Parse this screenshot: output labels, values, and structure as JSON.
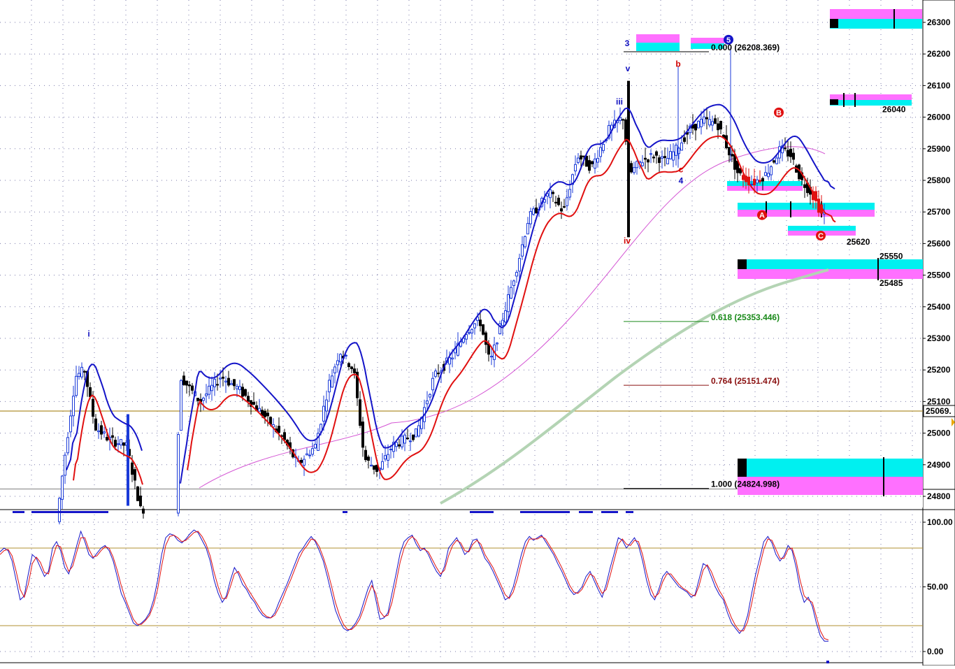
{
  "chart_data": [
    {
      "type": "candlestick",
      "title": "",
      "xlabel": "",
      "ylabel": "",
      "ylim": [
        24760,
        26360
      ],
      "y_ticks": [
        "26300",
        "26200",
        "26100",
        "26000",
        "25900",
        "25800",
        "25700",
        "25600",
        "25500",
        "25400",
        "25300",
        "25200",
        "25100",
        "25000",
        "24900",
        "24800"
      ],
      "current_price_label": "25069.",
      "grid": true,
      "colors": {
        "bull": "#1a3ad8",
        "bear": "#000000",
        "red_candle": "#e01010",
        "fast_band": "#1414c8",
        "slow_band": "#e01010",
        "sma_pink": "#d455d4",
        "sma_green": "#b4d4b4",
        "fib_zero": "#000000",
        "fib_618": "#1a8a1a",
        "fib_764": "#8a1010",
        "fib_1000": "#000000",
        "box_cyan": "#00f0f0",
        "box_magenta": "#ff70ff",
        "hline": "#b09030"
      },
      "fib_levels": [
        {
          "label": "0.000",
          "value_text": "(26208.369)",
          "price": 26208.369
        },
        {
          "label": "0.618",
          "value_text": "(25353.446)",
          "price": 25353.446
        },
        {
          "label": "0.764",
          "value_text": "(25151.474)",
          "price": 25151.474
        },
        {
          "label": "1.000",
          "value_text": "(24824.998)",
          "price": 24824.998
        }
      ],
      "level_labels": [
        {
          "text": "26040",
          "price": 26025
        },
        {
          "text": "25620",
          "price": 25605
        },
        {
          "text": "25550",
          "price": 25560
        },
        {
          "text": "25485",
          "price": 25475
        }
      ],
      "wave_labels": [
        {
          "text": "i",
          "color": "blue",
          "price": 25305
        },
        {
          "text": "3",
          "color": "blue",
          "price": 26225
        },
        {
          "text": "v",
          "color": "blue",
          "price": 26145
        },
        {
          "text": "iii",
          "color": "blue",
          "price": 26040
        },
        {
          "text": "iv",
          "color": "red",
          "price": 25600
        },
        {
          "text": "b",
          "color": "red",
          "price": 26160
        },
        {
          "text": "c",
          "color": "red",
          "price": 25825
        },
        {
          "text": "4",
          "color": "blue",
          "price": 25790
        },
        {
          "text": "5",
          "color": "circle-blue",
          "price": 26245
        },
        {
          "text": "B",
          "color": "circle-red",
          "price": 26015
        },
        {
          "text": "A",
          "color": "circle-red",
          "price": 25690
        },
        {
          "text": "C",
          "color": "circle-red",
          "price": 25625
        }
      ]
    },
    {
      "type": "line",
      "title": "",
      "ylim": [
        0,
        100
      ],
      "y_ticks": [
        "100.00",
        "50.00",
        "0.00"
      ],
      "reference_levels": [
        80,
        20
      ],
      "series": [
        {
          "color": "#1414c8",
          "values": [
            77,
            80,
            78,
            70,
            55,
            40,
            43,
            60,
            75,
            72,
            65,
            58,
            62,
            80,
            85,
            78,
            65,
            60,
            70,
            82,
            93,
            85,
            75,
            72,
            76,
            80,
            82,
            78,
            70,
            58,
            45,
            38,
            30,
            22,
            20,
            22,
            25,
            30,
            40,
            55,
            75,
            88,
            91,
            90,
            86,
            84,
            87,
            91,
            94,
            92,
            86,
            80,
            70,
            55,
            45,
            38,
            43,
            55,
            65,
            60,
            52,
            48,
            42,
            38,
            32,
            28,
            26,
            26,
            30,
            38,
            45,
            52,
            60,
            68,
            76,
            80,
            85,
            89,
            85,
            78,
            70,
            58,
            45,
            32,
            24,
            18,
            16,
            18,
            22,
            28,
            38,
            48,
            55,
            40,
            25,
            26,
            30,
            45,
            60,
            76,
            85,
            88,
            90,
            83,
            78,
            80,
            75,
            68,
            62,
            58,
            66,
            80,
            84,
            88,
            82,
            75,
            78,
            86,
            87,
            80,
            72,
            68,
            62,
            55,
            48,
            40,
            42,
            50,
            62,
            75,
            85,
            89,
            86,
            88,
            90,
            85,
            80,
            75,
            68,
            62,
            55,
            48,
            44,
            46,
            50,
            58,
            62,
            55,
            48,
            42,
            52,
            65,
            76,
            88,
            86,
            80,
            84,
            88,
            82,
            70,
            55,
            44,
            40,
            48,
            58,
            62,
            58,
            54,
            50,
            48,
            46,
            42,
            44,
            56,
            68,
            66,
            58,
            50,
            44,
            40,
            30,
            22,
            18,
            14,
            18,
            28,
            45,
            60,
            72,
            85,
            89,
            84,
            75,
            70,
            74,
            82,
            78,
            65,
            48,
            38,
            42,
            35,
            22,
            12,
            8,
            8
          ]
        },
        {
          "color": "#e01010",
          "values": [
            75,
            78,
            79,
            74,
            62,
            48,
            42,
            52,
            68,
            73,
            69,
            61,
            60,
            72,
            82,
            81,
            70,
            62,
            66,
            77,
            88,
            88,
            79,
            73,
            74,
            78,
            81,
            80,
            73,
            63,
            51,
            41,
            33,
            25,
            21,
            21,
            24,
            28,
            36,
            48,
            66,
            82,
            89,
            90,
            88,
            85,
            86,
            89,
            92,
            93,
            89,
            83,
            74,
            61,
            50,
            41,
            41,
            50,
            60,
            62,
            56,
            50,
            45,
            40,
            35,
            30,
            27,
            26,
            28,
            34,
            41,
            49,
            56,
            64,
            72,
            78,
            82,
            87,
            86,
            81,
            73,
            63,
            51,
            38,
            28,
            21,
            17,
            17,
            20,
            25,
            33,
            43,
            51,
            45,
            31,
            27,
            28,
            38,
            53,
            69,
            80,
            86,
            89,
            86,
            80,
            79,
            77,
            71,
            65,
            60,
            63,
            74,
            82,
            86,
            84,
            78,
            77,
            83,
            86,
            83,
            75,
            70,
            65,
            58,
            51,
            44,
            41,
            46,
            56,
            69,
            80,
            87,
            87,
            87,
            89,
            87,
            82,
            77,
            71,
            65,
            58,
            51,
            46,
            45,
            48,
            54,
            60,
            58,
            51,
            45,
            48,
            59,
            71,
            83,
            87,
            83,
            82,
            86,
            85,
            75,
            61,
            49,
            42,
            45,
            54,
            60,
            60,
            56,
            52,
            49,
            47,
            44,
            43,
            51,
            63,
            67,
            62,
            54,
            47,
            42,
            34,
            26,
            20,
            16,
            16,
            23,
            37,
            53,
            66,
            79,
            87,
            86,
            79,
            72,
            72,
            79,
            80,
            70,
            55,
            43,
            40,
            38,
            27,
            16,
            10,
            9
          ]
        }
      ]
    }
  ]
}
